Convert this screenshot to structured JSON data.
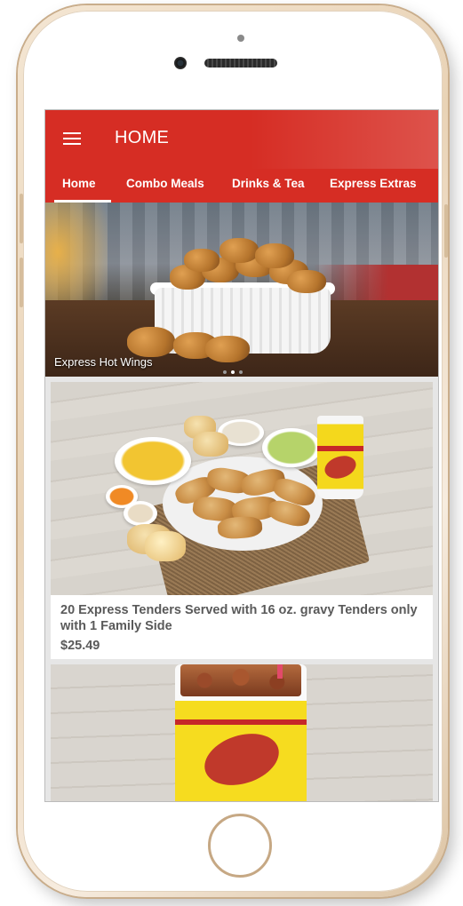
{
  "app": {
    "title": "HOME"
  },
  "tabs": [
    {
      "label": "Home",
      "active": true
    },
    {
      "label": "Combo Meals",
      "active": false
    },
    {
      "label": "Drinks & Tea",
      "active": false
    },
    {
      "label": "Express Extras",
      "active": false
    }
  ],
  "banner": {
    "caption": "Express Hot Wings",
    "slides_total": 3,
    "active_slide": 2
  },
  "products": [
    {
      "title": "20 Express Tenders Served with 16 oz. gravy Tenders only with 1 Family Side",
      "price": "$25.49"
    }
  ],
  "colors": {
    "app_bar": "#d62d24",
    "text": "#5a5a5a",
    "background": "#e6e6e6"
  },
  "icons": {
    "menu": "hamburger-menu-icon"
  }
}
